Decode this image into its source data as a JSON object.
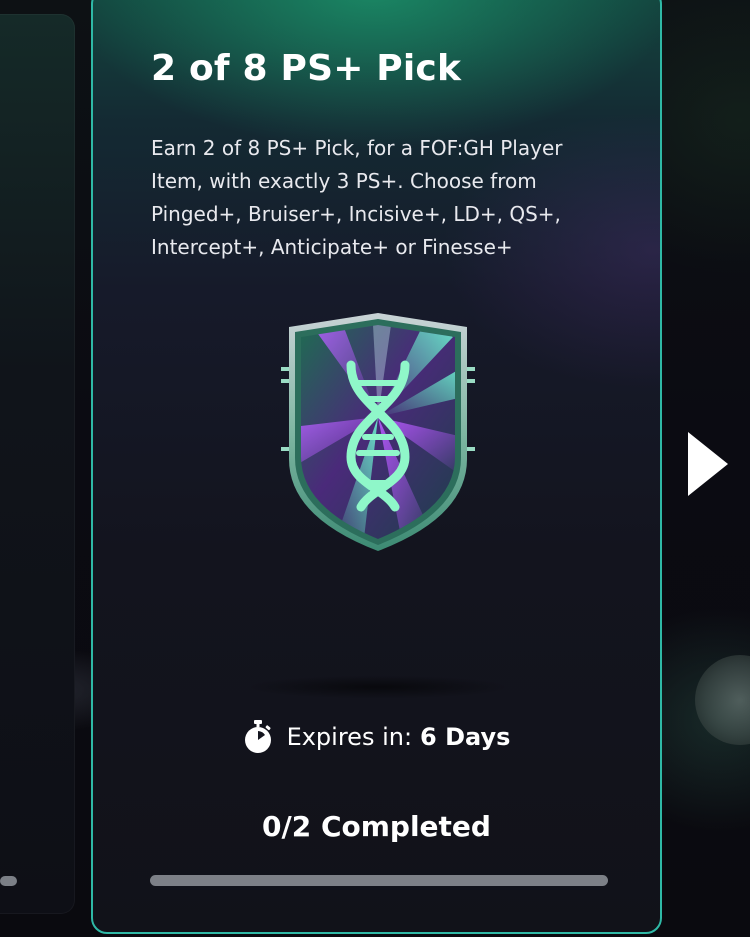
{
  "objective": {
    "title": "2 of 8 PS+ Pick",
    "description": "Earn 2 of 8 PS+ Pick, for a FOF:GH Player Item, with exactly 3 PS+. Choose from Pinged+, Bruiser+, Incisive+, LD+, QS+, Intercept+, Anticipate+ or Finesse+",
    "badge_icon": "dna-shield-icon",
    "expires_label": "Expires in:",
    "expires_value": "6 Days",
    "progress_text": "0/2 Completed",
    "progress_current": 0,
    "progress_total": 2
  },
  "navigation": {
    "next_icon": "play-arrow-right-icon"
  },
  "colors": {
    "accent": "#2fb9a6",
    "card_top": "#13463f",
    "card_bottom": "#111219",
    "progress_track": "#7d8087"
  }
}
